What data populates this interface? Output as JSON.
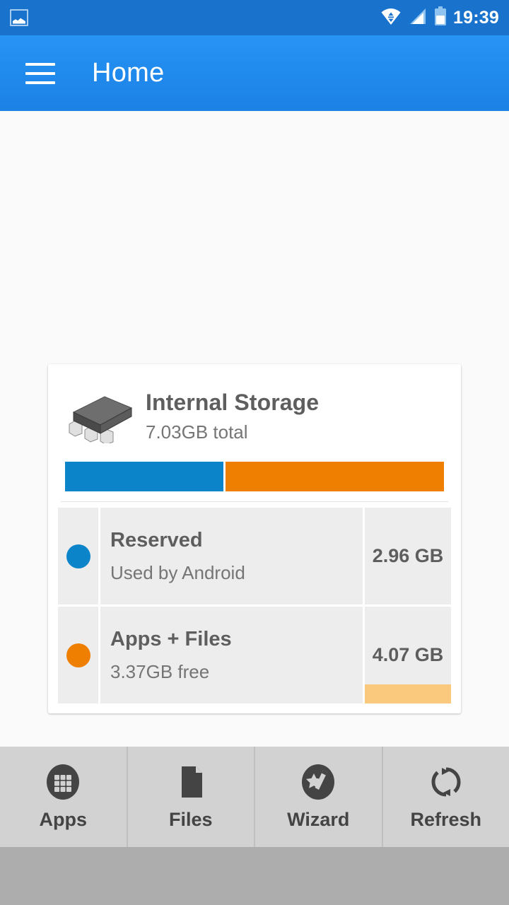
{
  "status_bar": {
    "notification_icon": "photo-icon",
    "wifi_icon": "wifi-icon",
    "signal_icon": "cellular-signal-icon",
    "battery_icon": "battery-icon",
    "time": "19:39",
    "background_color": "#1973cd"
  },
  "app_bar": {
    "menu_icon": "hamburger-menu-icon",
    "title": "Home",
    "background_color": "#2089ec"
  },
  "card": {
    "icon": "memory-chip-icon",
    "title": "Internal Storage",
    "subtitle": "7.03GB total",
    "usage_bar": [
      {
        "name": "Reserved",
        "percent": 42,
        "color": "#0b84c9"
      },
      {
        "name": "Apps + Files",
        "percent": 58,
        "color": "#ef7f00"
      }
    ],
    "legend": [
      {
        "dot_color": "#0b84c9",
        "name": "Reserved",
        "description": "Used by Android",
        "value": "2.96 GB",
        "highlight_color": null,
        "highlight_percent": 0
      },
      {
        "dot_color": "#ef7f00",
        "name": "Apps + Files",
        "description": "3.37GB free",
        "value": "4.07 GB",
        "highlight_color": "#fbc97e",
        "highlight_percent": 20
      }
    ]
  },
  "toolbar": {
    "buttons": [
      {
        "icon": "apps-grid-icon",
        "label": "Apps"
      },
      {
        "icon": "file-document-icon",
        "label": "Files"
      },
      {
        "icon": "magic-wand-icon",
        "label": "Wizard"
      },
      {
        "icon": "refresh-icon",
        "label": "Refresh"
      }
    ],
    "background_color": "#d2d2d2"
  },
  "nav_bar": {
    "background_color": "#adadad"
  },
  "theme": {
    "content_background": "#fafafa",
    "card_background": "#ffffff",
    "cell_background": "#ededed",
    "text_primary": "#5e5e5e",
    "text_secondary": "#757575"
  }
}
